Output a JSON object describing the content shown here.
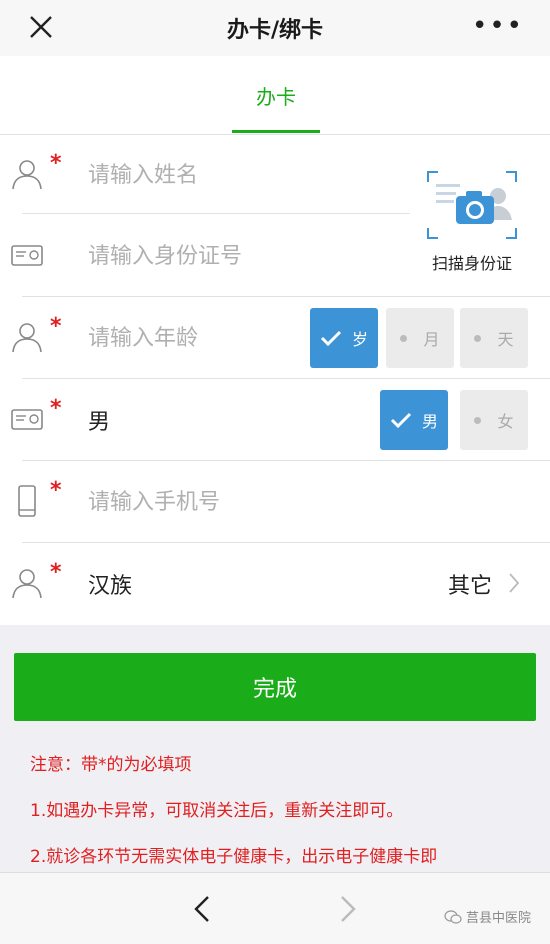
{
  "header": {
    "title": "办卡/绑卡"
  },
  "tabs": [
    {
      "label": "办卡",
      "active": true
    }
  ],
  "form": {
    "name": {
      "placeholder": "请输入姓名",
      "required": true
    },
    "id_card": {
      "placeholder": "请输入身份证号",
      "required": false
    },
    "scan_label": "扫描身份证",
    "age": {
      "placeholder": "请输入年龄",
      "required": true,
      "units": [
        "岁",
        "月",
        "天"
      ],
      "selected_unit": "岁"
    },
    "gender": {
      "value": "男",
      "required": true,
      "options": [
        "男",
        "女"
      ],
      "selected": "男"
    },
    "phone": {
      "placeholder": "请输入手机号",
      "required": true
    },
    "nation": {
      "value": "汉族",
      "required": true,
      "other_label": "其它"
    }
  },
  "submit_label": "完成",
  "notes": [
    "注意：带*的为必填项",
    "1.如遇办卡异常，可取消关注后，重新关注即可。",
    "2.就诊各环节无需实体电子健康卡，出示电子健康卡即"
  ],
  "watermark": "莒县中医院",
  "colors": {
    "accent_green": "#1aad19",
    "selected_blue": "#3c93d6",
    "required_red": "#e02020"
  },
  "icons": [
    "close-icon",
    "more-icon",
    "person-icon",
    "id-card-icon",
    "phone-icon",
    "camera-icon",
    "check-icon",
    "chevron-right-icon",
    "back-arrow-icon",
    "forward-arrow-icon",
    "wechat-icon"
  ]
}
